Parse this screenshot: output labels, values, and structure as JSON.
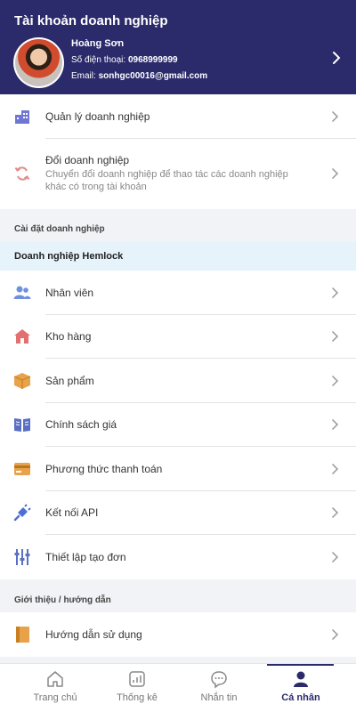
{
  "header": {
    "title": "Tài khoản doanh nghiệp",
    "name": "Hoàng Sơn",
    "phone_label": "Số điện thoại:",
    "phone": "0968999999",
    "email_label": "Email:",
    "email": "sonhgc00016@gmail.com"
  },
  "account": {
    "manage": "Quản lý doanh nghiệp",
    "switch_title": "Đổi doanh nghiệp",
    "switch_desc": "Chuyển đổi doanh nghiệp để thao tác các doanh nghiệp khác có trong tài khoản"
  },
  "settings": {
    "section_title": "Cài đặt doanh nghiệp",
    "business_name": "Doanh nghiệp Hemlock",
    "items": [
      {
        "label": "Nhân viên",
        "icon": "users-icon"
      },
      {
        "label": "Kho hàng",
        "icon": "warehouse-icon"
      },
      {
        "label": "Sản phẩm",
        "icon": "box-icon"
      },
      {
        "label": "Chính sách giá",
        "icon": "book-icon"
      },
      {
        "label": "Phương thức thanh toán",
        "icon": "credit-card-icon"
      },
      {
        "label": "Kết nối API",
        "icon": "plug-icon"
      },
      {
        "label": "Thiết lập tạo đơn",
        "icon": "sliders-icon"
      }
    ]
  },
  "guide": {
    "section_title": "Giới thiệu / hướng dẫn",
    "items": [
      {
        "label": "Hướng dẫn sử dụng",
        "icon": "guide-book-icon"
      }
    ]
  },
  "tabs": [
    {
      "label": "Trang chủ",
      "icon": "home-icon"
    },
    {
      "label": "Thống kê",
      "icon": "chart-icon"
    },
    {
      "label": "Nhắn tin",
      "icon": "chat-icon"
    },
    {
      "label": "Cá nhân",
      "icon": "person-icon",
      "active": true
    }
  ],
  "colors": {
    "header_bg": "#2b2a6b",
    "band_bg": "#e6f3fb",
    "accent": "#2b2a6b"
  }
}
